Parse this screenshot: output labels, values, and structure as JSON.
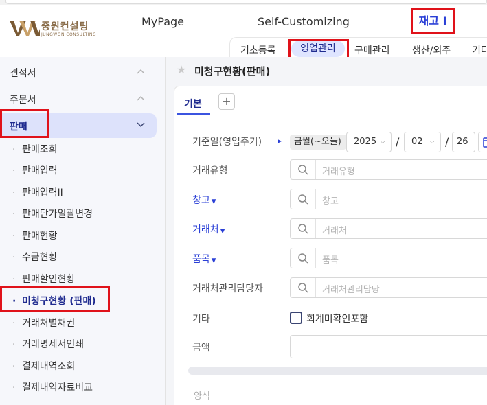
{
  "brand": {
    "name_ko": "중원컨설팅",
    "name_en": "JUNGWON CONSULTING",
    "color": "#8a6d4a"
  },
  "topnav": {
    "mypage": "MyPage",
    "custom": "Self-Customizing",
    "jaego": "재고 I"
  },
  "subnav": [
    "기초등록",
    "영업관리",
    "구매관리",
    "생산/외주",
    "기타"
  ],
  "sidebar": {
    "groups": [
      {
        "label": "견적서",
        "chevron": "chevron-up-icon"
      },
      {
        "label": "주문서",
        "chevron": "chevron-up-icon"
      },
      {
        "label": "판매",
        "chevron": "chevron-down-icon"
      }
    ],
    "items": [
      "판매조회",
      "판매입력",
      "판매입력II",
      "판매단가일괄변경",
      "판매현황",
      "수금현황",
      "판매할인현황",
      "미청구현황 (판매)",
      "거래처별채권",
      "거래명세서인쇄",
      "결제내역조회",
      "결제내역자료비교"
    ]
  },
  "page": {
    "title": "미청구현황(판매)"
  },
  "tabs": {
    "basic": "기본",
    "add": "+"
  },
  "form": {
    "date": {
      "label": "기준일(영업주기)",
      "mode": "금월(~오늘)",
      "year": "2025",
      "month": "02",
      "day": "26"
    },
    "trade_type": {
      "label": "거래유형",
      "placeholder": "거래유형"
    },
    "warehouse": {
      "label": "창고",
      "placeholder": "창고"
    },
    "customer": {
      "label": "거래처",
      "placeholder": "거래처"
    },
    "item": {
      "label": "품목",
      "placeholder": "품목"
    },
    "manager": {
      "label": "거래처관리담당자",
      "placeholder": "거래처관리담당"
    },
    "etc": {
      "label": "기타",
      "checkbox_label": "회계미확인포함"
    },
    "amount": {
      "label": "금액"
    },
    "format": {
      "label": "양식"
    }
  },
  "colors": {
    "highlight": "#e0121a",
    "accent": "#2a3fd6",
    "active_bg": "#dde2fb"
  }
}
